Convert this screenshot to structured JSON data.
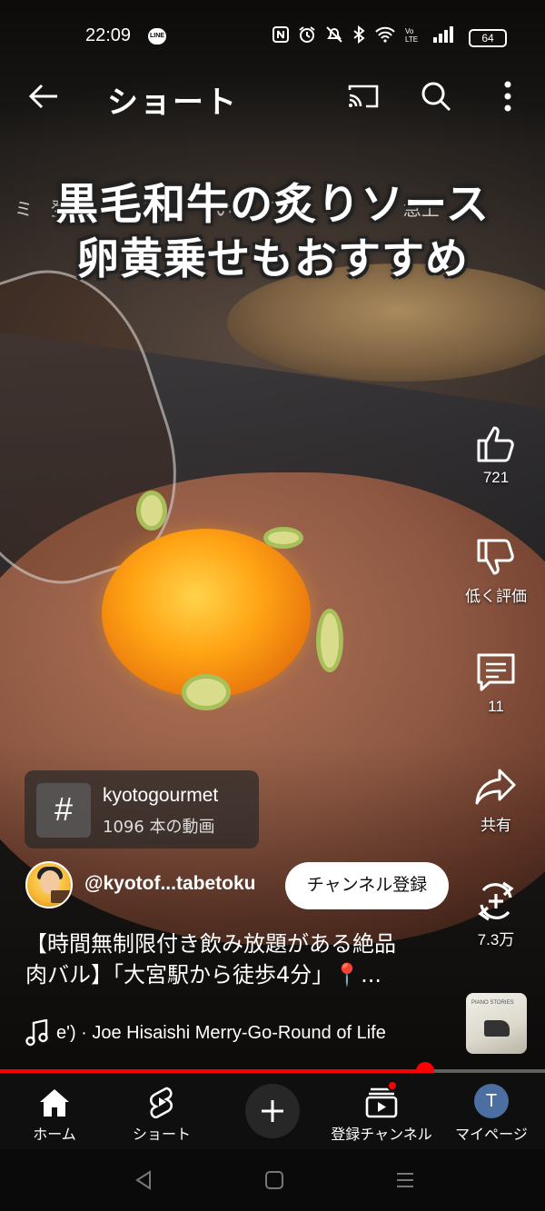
{
  "status_bar": {
    "time": "22:09",
    "line_badge": "LINE",
    "battery": "64"
  },
  "top_bar": {
    "title": "ショート"
  },
  "video": {
    "caption_line1": "黒毛和牛の炙りソース",
    "caption_line2": "卵黄乗せもおすすめ",
    "ghost_text": "ミ　登録　ー　ンル　　い)　イヴ　　　　　　急上"
  },
  "actions": {
    "like_count": "721",
    "dislike_label": "低く評価",
    "comment_count": "11",
    "share_label": "共有",
    "remix_count": "7.3万"
  },
  "hashtag": {
    "symbol": "#",
    "tag": "kyotogourmet",
    "count": "1096 本の動画"
  },
  "channel": {
    "handle": "@kyotof...tabetoku",
    "subscribe_label": "チャンネル登録"
  },
  "description": {
    "line1": "【時間無制限付き飲み放題がある絶品",
    "line2": "肉バル】「大宮駅から徒歩4分」📍..."
  },
  "music": {
    "text": "e') · Joe Hisaishi     Merry-Go-Round of Life",
    "thumb_text": "PIANO STORIES"
  },
  "progress": {
    "fraction": 0.78
  },
  "bottom_nav": {
    "home": "ホーム",
    "shorts": "ショート",
    "subscriptions": "登録チャンネル",
    "you": "マイページ",
    "you_initial": "T"
  },
  "colors": {
    "accent": "#ff0000",
    "nav_bg": "#0f0f0f"
  }
}
